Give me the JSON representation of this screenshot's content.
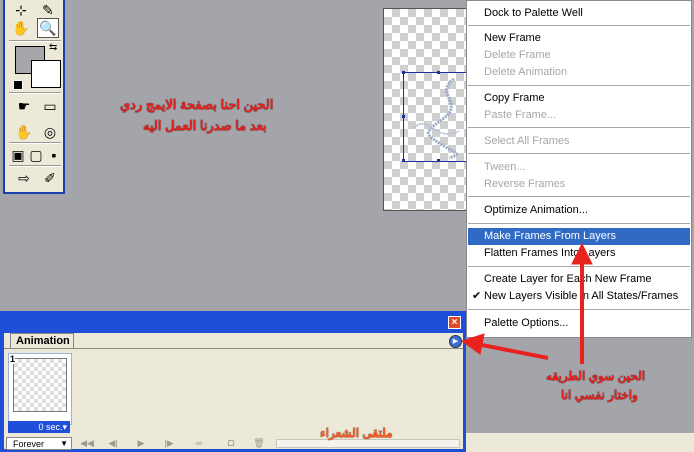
{
  "toolbox": {
    "tools": [
      {
        "name": "crop-tool-icon",
        "glyph": "⊹"
      },
      {
        "name": "eyedropper-tool-icon",
        "glyph": "✎"
      },
      {
        "name": "hand-tool-icon",
        "glyph": "✋"
      },
      {
        "name": "zoom-tool-icon",
        "glyph": "🔍"
      },
      {
        "name": "mode-1-icon",
        "glyph": "☛"
      },
      {
        "name": "mode-2-icon",
        "glyph": "▭"
      },
      {
        "name": "mode-3-icon",
        "glyph": "✋"
      },
      {
        "name": "mode-4-icon",
        "glyph": "◎"
      },
      {
        "name": "screen-1-icon",
        "glyph": "▣"
      },
      {
        "name": "screen-2-icon",
        "glyph": "▢"
      },
      {
        "name": "screen-3-icon",
        "glyph": "▪"
      },
      {
        "name": "jump-to-imageready-icon",
        "glyph": "⇨"
      },
      {
        "name": "edit-icon",
        "glyph": "✐"
      }
    ]
  },
  "menu": {
    "items": [
      {
        "label": "Dock to Palette Well",
        "state": "normal"
      },
      {
        "label": "New Frame",
        "state": "normal"
      },
      {
        "label": "Delete Frame",
        "state": "disabled"
      },
      {
        "label": "Delete Animation",
        "state": "disabled"
      },
      {
        "label": "Copy Frame",
        "state": "normal"
      },
      {
        "label": "Paste Frame...",
        "state": "disabled"
      },
      {
        "label": "Select All Frames",
        "state": "disabled"
      },
      {
        "label": "Tween...",
        "state": "disabled"
      },
      {
        "label": "Reverse Frames",
        "state": "disabled"
      },
      {
        "label": "Optimize Animation...",
        "state": "normal"
      },
      {
        "label": "Make Frames From Layers",
        "state": "highlighted"
      },
      {
        "label": "Flatten Frames Into Layers",
        "state": "normal"
      },
      {
        "label": "Create Layer for Each New Frame",
        "state": "normal"
      },
      {
        "label": "New Layers Visible in All States/Frames",
        "state": "checked"
      },
      {
        "label": "Palette Options...",
        "state": "normal"
      }
    ]
  },
  "animation_panel": {
    "tab_label": "Animation",
    "close_glyph": "×",
    "flyout_glyph": "▶",
    "frame_number": "1",
    "frame_delay": "0 sec.▾",
    "loop_option": "Forever",
    "controls": [
      "◀◀",
      "◀|",
      "▶",
      "|▶",
      "∞",
      "□",
      "🗑"
    ]
  },
  "annotations": {
    "top_line1": "الحين احنا بصفحة الايمج ردي",
    "top_line2": "بعد ما صدرنا العمل اليه",
    "right_line1": "الحين سوي الطريقه",
    "right_line2": "واختار نفسي انا",
    "watermark": "ملتقى الشعراء"
  },
  "colors": {
    "annotation": "#e8231f",
    "menu_highlight": "#316ac5",
    "panel_frame": "#1f4fd8"
  }
}
